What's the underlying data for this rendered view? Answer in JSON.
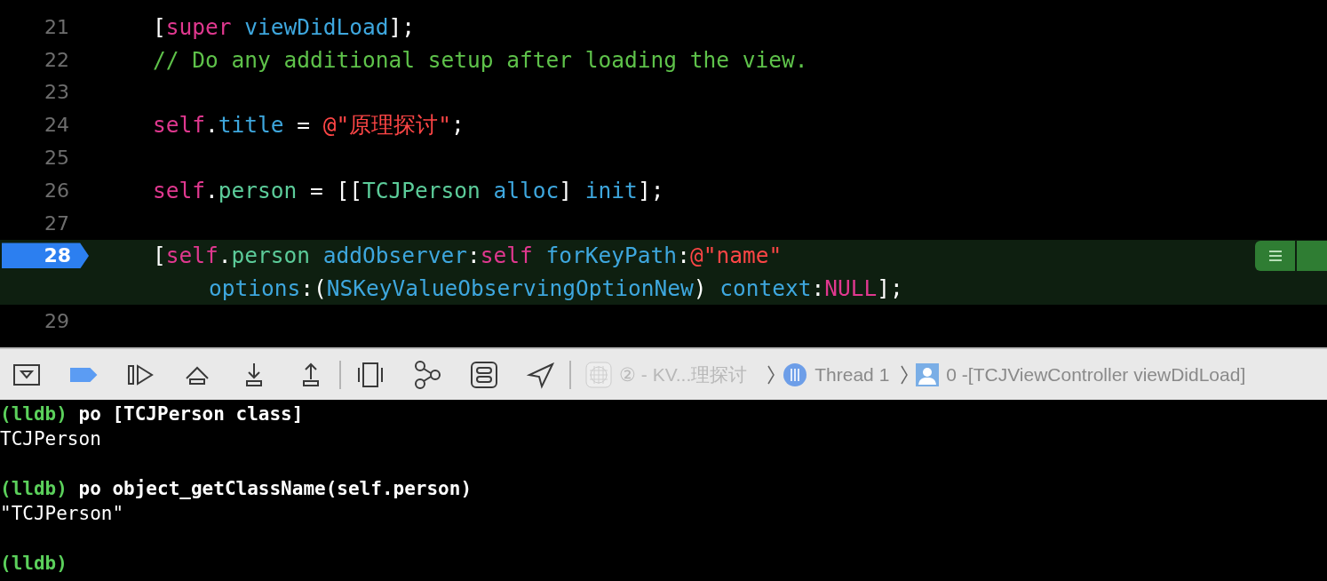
{
  "editor": {
    "lines": [
      {
        "number": "21",
        "highlighted": false,
        "breakpoint": false,
        "tokens": [
          {
            "kind": "plain",
            "text": "["
          },
          {
            "kind": "keyword",
            "text": "super"
          },
          {
            "kind": "system",
            "text": " viewDidLoad"
          },
          {
            "kind": "plain",
            "text": "];"
          }
        ]
      },
      {
        "number": "22",
        "highlighted": false,
        "breakpoint": false,
        "tokens": [
          {
            "kind": "comment",
            "text": "// Do any additional setup after loading the view."
          }
        ]
      },
      {
        "number": "23",
        "highlighted": false,
        "breakpoint": false
      },
      {
        "number": "24",
        "highlighted": false,
        "breakpoint": false,
        "tokens": [
          {
            "kind": "keyword",
            "text": "self"
          },
          {
            "kind": "plain",
            "text": "."
          },
          {
            "kind": "system",
            "text": "title"
          },
          {
            "kind": "plain",
            "text": " = "
          },
          {
            "kind": "string",
            "text": "@\"原理探讨\""
          },
          {
            "kind": "plain",
            "text": ";"
          }
        ]
      },
      {
        "number": "25",
        "highlighted": false,
        "breakpoint": false
      },
      {
        "number": "26",
        "highlighted": false,
        "breakpoint": false,
        "tokens": [
          {
            "kind": "keyword",
            "text": "self"
          },
          {
            "kind": "plain",
            "text": "."
          },
          {
            "kind": "project",
            "text": "person"
          },
          {
            "kind": "plain",
            "text": " = [["
          },
          {
            "kind": "project",
            "text": "TCJPerson"
          },
          {
            "kind": "system",
            "text": " alloc"
          },
          {
            "kind": "plain",
            "text": "] "
          },
          {
            "kind": "system",
            "text": "init"
          },
          {
            "kind": "plain",
            "text": "];"
          }
        ]
      },
      {
        "number": "27",
        "highlighted": false,
        "breakpoint": false
      },
      {
        "number": "28",
        "highlighted": true,
        "breakpoint": true,
        "tokens": [
          {
            "kind": "plain",
            "text": "["
          },
          {
            "kind": "keyword",
            "text": "self"
          },
          {
            "kind": "plain",
            "text": "."
          },
          {
            "kind": "project",
            "text": "person"
          },
          {
            "kind": "system",
            "text": " addObserver"
          },
          {
            "kind": "plain",
            "text": ":"
          },
          {
            "kind": "keyword",
            "text": "self"
          },
          {
            "kind": "system",
            "text": " forKeyPath"
          },
          {
            "kind": "plain",
            "text": ":"
          },
          {
            "kind": "string",
            "text": "@\"name\""
          }
        ]
      },
      {
        "highlighted": true,
        "continuation": true,
        "tokens": [
          {
            "kind": "system",
            "text": "options"
          },
          {
            "kind": "plain",
            "text": ":("
          },
          {
            "kind": "system",
            "text": "NSKeyValueObservingOptionNew"
          },
          {
            "kind": "plain",
            "text": ") "
          },
          {
            "kind": "system",
            "text": "context"
          },
          {
            "kind": "plain",
            "text": ":"
          },
          {
            "kind": "keyword",
            "text": "NULL"
          },
          {
            "kind": "plain",
            "text": "];"
          }
        ]
      },
      {
        "number": "29",
        "highlighted": false,
        "breakpoint": false
      }
    ]
  },
  "debug_bar": {
    "breakpoints_active": true,
    "breadcrumb": [
      {
        "kind": "app",
        "text": "② - KV...理探讨"
      },
      {
        "kind": "thread",
        "text": "Thread 1"
      },
      {
        "kind": "frame",
        "text": "0 -[TCJViewController viewDidLoad]"
      }
    ]
  },
  "console": {
    "lines": [
      {
        "kind": "command",
        "prompt": "(lldb)",
        "text": "po [TCJPerson class]"
      },
      {
        "kind": "output",
        "text": "TCJPerson"
      },
      {
        "kind": "blank"
      },
      {
        "kind": "command",
        "prompt": "(lldb)",
        "text": "po object_getClassName(self.person)"
      },
      {
        "kind": "output",
        "text": "\"TCJPerson\""
      },
      {
        "kind": "blank"
      },
      {
        "kind": "command",
        "prompt": "(lldb)"
      }
    ]
  }
}
